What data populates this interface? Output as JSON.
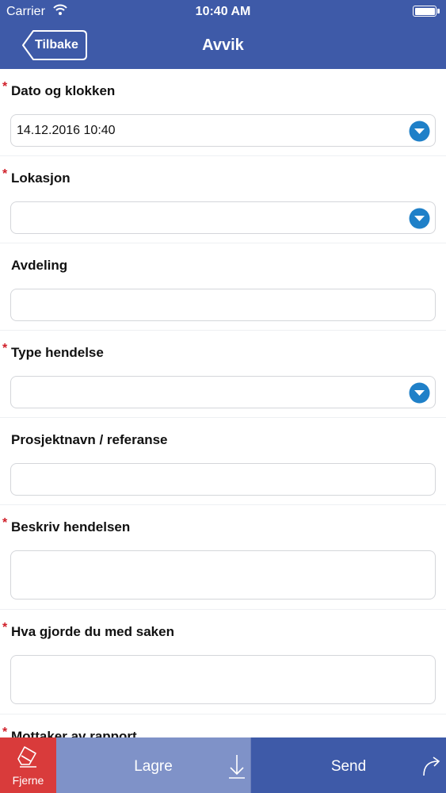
{
  "status_bar": {
    "carrier": "Carrier",
    "time": "10:40 AM"
  },
  "nav": {
    "back_label": "Tilbake",
    "title": "Avvik"
  },
  "form": {
    "date_label": "Dato og klokken",
    "date_value": "14.12.2016 10:40",
    "location_label": "Lokasjon",
    "location_value": "",
    "department_label": "Avdeling",
    "department_value": "",
    "event_type_label": "Type hendelse",
    "event_type_value": "",
    "project_label": "Prosjektnavn / referanse",
    "project_value": "",
    "describe_label": "Beskriv hendelsen",
    "describe_value": "",
    "action_label": "Hva gjorde du med saken",
    "action_value": "",
    "recipient_label": "Mottaker av rapport",
    "required_mark": "*"
  },
  "bottom": {
    "remove_label": "Fjerne",
    "save_label": "Lagre",
    "send_label": "Send"
  },
  "colors": {
    "navbar": "#3e5aa8",
    "accent": "#1f80c8",
    "required": "#d0202a",
    "remove": "#d93b3b",
    "save": "#7f92c8"
  }
}
